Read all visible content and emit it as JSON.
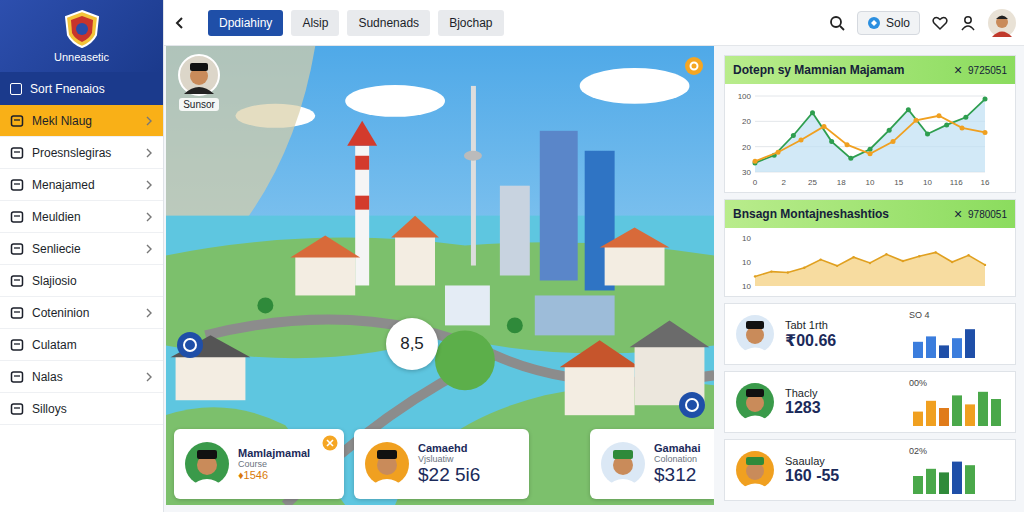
{
  "sidebar": {
    "brand": "Unneasetic",
    "items": [
      {
        "label": "Sort Fnenaios",
        "kind": "checkbox",
        "checked": false,
        "selected": false,
        "chevron": false
      },
      {
        "label": "Mekl Nlaug",
        "kind": "link",
        "selected": true,
        "chevron": true
      },
      {
        "label": "Proesnslegiras",
        "kind": "link",
        "selected": false,
        "chevron": true
      },
      {
        "label": "Menajamed",
        "kind": "link",
        "selected": false,
        "chevron": true
      },
      {
        "label": "Meuldien",
        "kind": "link",
        "selected": false,
        "chevron": true
      },
      {
        "label": "Senliecie",
        "kind": "link",
        "selected": false,
        "chevron": true
      },
      {
        "label": "Slajiosio",
        "kind": "link",
        "selected": false,
        "chevron": false
      },
      {
        "label": "Coteninion",
        "kind": "link",
        "selected": false,
        "chevron": true
      },
      {
        "label": "Culatam",
        "kind": "link",
        "selected": false,
        "chevron": false
      },
      {
        "label": "Nalas",
        "kind": "link",
        "selected": false,
        "chevron": true
      },
      {
        "label": "Silloys",
        "kind": "link",
        "selected": false,
        "chevron": false
      }
    ]
  },
  "topbar": {
    "tabs": [
      {
        "label": "Dpdiahiny",
        "selected": true
      },
      {
        "label": "Alsip",
        "selected": false
      },
      {
        "label": "Sudnenads",
        "selected": false
      },
      {
        "label": "Bjochap",
        "selected": false
      }
    ],
    "solo_button": "Solo"
  },
  "map": {
    "profile_label": "Sunsor",
    "score": "8,5",
    "cards": [
      {
        "name": "Mamlajmamal",
        "sub": "Course",
        "value": "♦1546",
        "kind": "small"
      },
      {
        "name": "Camaehd",
        "sub": "Vjsluatiw",
        "value": "$22 5i6",
        "kind": "large"
      },
      {
        "name": "Gamahai",
        "sub": "Colonation",
        "value": "$312",
        "kind": "large"
      }
    ]
  },
  "panel": {
    "line_chart": {
      "title": "Dotepn sy Mamnian Majamam",
      "close": "×",
      "code": "9725051",
      "y_ticks": [
        "100",
        "20",
        "20",
        "30"
      ],
      "x_ticks": [
        "0",
        "2",
        "25",
        "18",
        "10",
        "15",
        "10",
        "116",
        "16"
      ],
      "series": [
        {
          "color": "#2e9e4f",
          "values": [
            12,
            22,
            48,
            78,
            40,
            18,
            30,
            55,
            82,
            50,
            62,
            72,
            96
          ]
        },
        {
          "color": "#f0a020",
          "values": [
            14,
            26,
            42,
            60,
            36,
            24,
            40,
            68,
            74,
            58,
            52
          ]
        }
      ]
    },
    "area_chart": {
      "title": "Bnsagn Montajneshashtios",
      "close": "×",
      "code": "9780051",
      "y_ticks": [
        "10",
        "10",
        "10"
      ],
      "values": [
        20,
        30,
        28,
        38,
        55,
        42,
        60,
        48,
        66,
        52,
        62,
        70,
        50,
        64,
        44
      ]
    },
    "rows": [
      {
        "name": "Tabt 1rth",
        "value": "₹00.66",
        "label": "SO 4",
        "bars": [
          {
            "value": 45,
            "color": "#3b7ddd"
          },
          {
            "value": 60,
            "color": "#3b7ddd"
          },
          {
            "value": 35,
            "color": "#1f4fa8"
          },
          {
            "value": 55,
            "color": "#3b7ddd"
          },
          {
            "value": 80,
            "color": "#1f4fa8"
          }
        ]
      },
      {
        "name": "Thacly",
        "value": "1283",
        "label": "00%",
        "bars": [
          {
            "value": 40,
            "color": "#f0a020"
          },
          {
            "value": 70,
            "color": "#f0a020"
          },
          {
            "value": 50,
            "color": "#e07b1a"
          },
          {
            "value": 85,
            "color": "#4aa84a"
          },
          {
            "value": 60,
            "color": "#f0a020"
          },
          {
            "value": 95,
            "color": "#4aa84a"
          },
          {
            "value": 75,
            "color": "#4aa84a"
          }
        ]
      },
      {
        "name": "Saaulay",
        "value": "160 -55",
        "label": "02%",
        "bars": [
          {
            "value": 50,
            "color": "#4aa84a"
          },
          {
            "value": 70,
            "color": "#4aa84a"
          },
          {
            "value": 60,
            "color": "#2f8a3a"
          },
          {
            "value": 90,
            "color": "#1f4fa8"
          },
          {
            "value": 80,
            "color": "#4aa84a"
          }
        ]
      }
    ]
  }
}
